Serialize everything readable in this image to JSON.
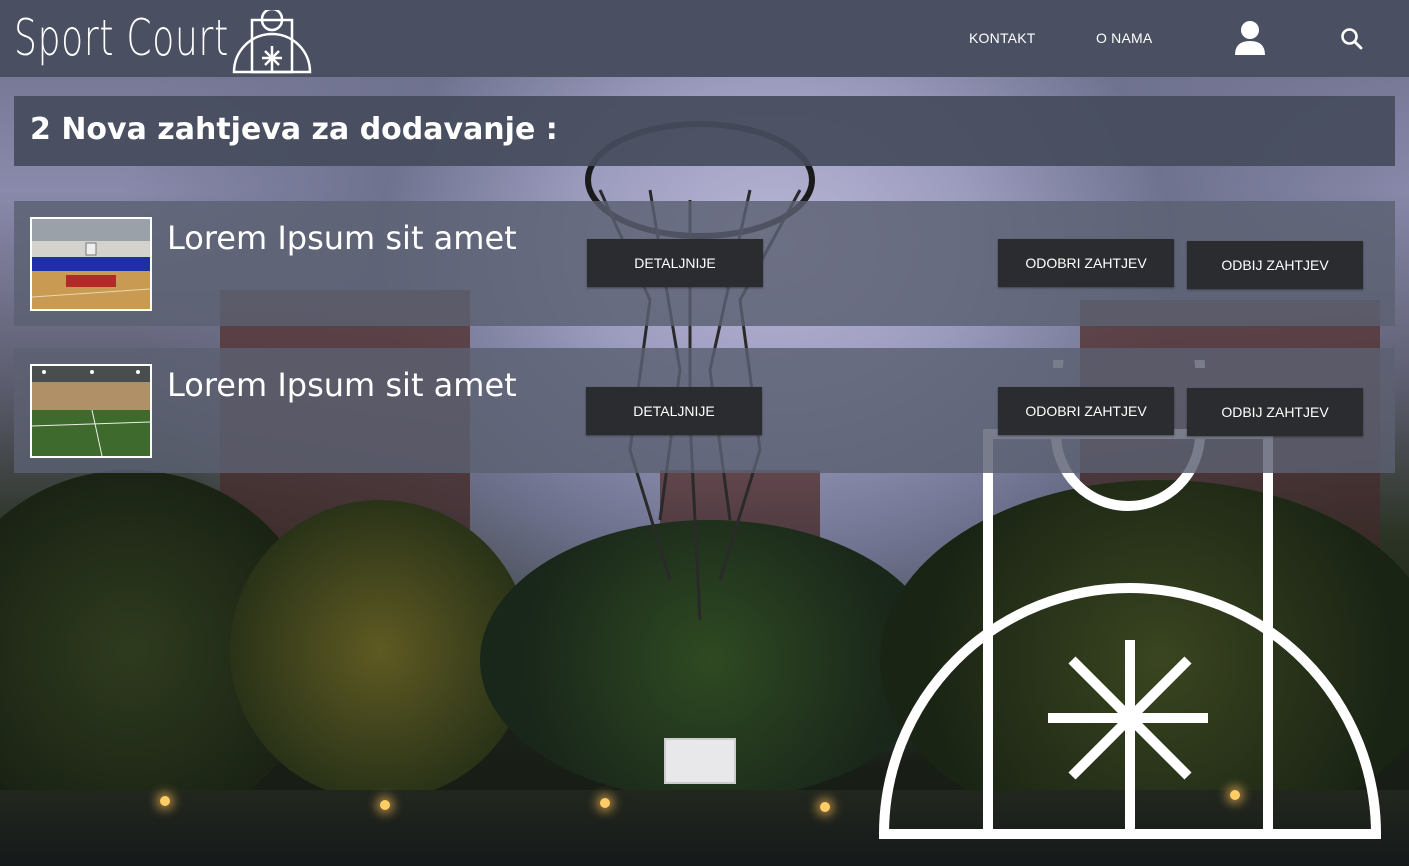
{
  "brand": {
    "name": "Sport Court"
  },
  "nav": {
    "links": [
      "KONTAKT",
      "O NAMA"
    ],
    "icons": [
      "user-icon",
      "search-icon"
    ]
  },
  "page": {
    "heading": "2 Nova zahtjeva za dodavanje :"
  },
  "requests": [
    {
      "title": "Lorem Ipsum sit amet",
      "thumbnail": "indoor basketball court",
      "details_label": "DETALJNIJE",
      "approve_label": "ODOBRI ZAHTJEV",
      "reject_label": "ODBIJ ZAHTJEV"
    },
    {
      "title": "Lorem Ipsum sit amet",
      "thumbnail": "indoor football turf field",
      "details_label": "DETALJNIJE",
      "approve_label": "ODOBRI ZAHTJEV",
      "reject_label": "ODBIJ ZAHTJEV"
    }
  ],
  "colors": {
    "header": "#4a5061",
    "panel": "#5c6072",
    "button": "#2b2c2f",
    "text": "#ffffff"
  }
}
